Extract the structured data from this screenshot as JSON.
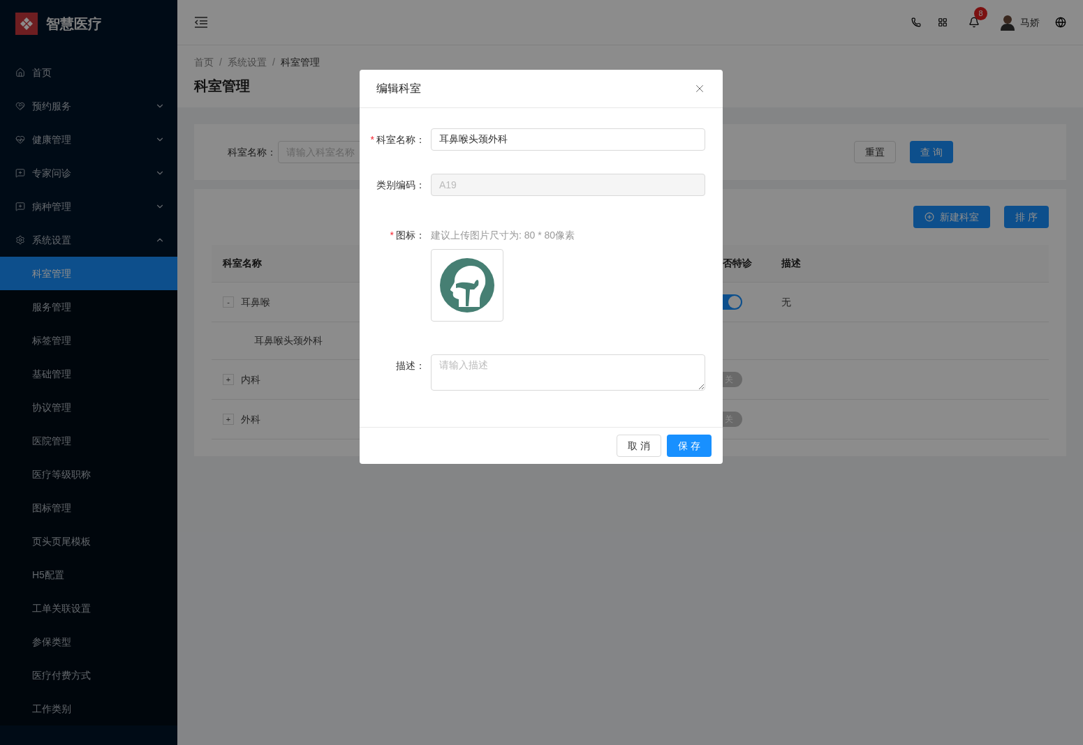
{
  "sidebar": {
    "logo_text": "智慧医疗",
    "items": [
      {
        "label": "首页"
      },
      {
        "label": "预约服务",
        "expanded": false
      },
      {
        "label": "健康管理",
        "expanded": false
      },
      {
        "label": "专家问诊",
        "expanded": false
      },
      {
        "label": "病种管理",
        "expanded": false
      },
      {
        "label": "系统设置",
        "expanded": true,
        "children": [
          {
            "label": "科室管理",
            "selected": true
          },
          {
            "label": "服务管理",
            "selected": false
          },
          {
            "label": "标签管理",
            "selected": false
          },
          {
            "label": "基础管理",
            "selected": false
          },
          {
            "label": "协议管理",
            "selected": false
          },
          {
            "label": "医院管理",
            "selected": false
          },
          {
            "label": "医疗等级职称",
            "selected": false
          },
          {
            "label": "图标管理",
            "selected": false
          },
          {
            "label": "页头页尾模板",
            "selected": false
          },
          {
            "label": "H5配置",
            "selected": false
          },
          {
            "label": "工单关联设置",
            "selected": false
          },
          {
            "label": "参保类型",
            "selected": false
          },
          {
            "label": "医疗付费方式",
            "selected": false
          },
          {
            "label": "工作类别",
            "selected": false
          }
        ]
      }
    ]
  },
  "header": {
    "notification_count": "8",
    "user_name": "马娇"
  },
  "breadcrumb": {
    "separator": "/",
    "items": [
      "首页",
      "系统设置",
      "科室管理"
    ]
  },
  "page_title": "科室管理",
  "search": {
    "label": "科室名称：",
    "placeholder": "请输入科室名称",
    "buttons": [
      {
        "label": "重置",
        "kind": "default"
      },
      {
        "label": "查 询",
        "kind": "primary"
      }
    ]
  },
  "table": {
    "actions": [
      {
        "label": "新建科室",
        "kind": "add"
      },
      {
        "label": "排 序",
        "kind": "plain"
      }
    ],
    "columns": [
      "科室名称",
      "否特诊",
      "描述"
    ],
    "rows": [
      {
        "expander": "-",
        "name": "耳鼻喉",
        "special": {
          "on": true
        },
        "description": "无",
        "children": [
          {
            "name": "耳鼻喉头颈外科"
          }
        ]
      },
      {
        "expander": "+",
        "name": "内科",
        "special": {
          "on": false,
          "label": "关"
        }
      },
      {
        "expander": "+",
        "name": "外科",
        "special": {
          "on": false,
          "label": "关"
        }
      }
    ]
  },
  "dialog": {
    "title": "编辑科室",
    "fields": [
      {
        "kind": "text",
        "required_mark": "*",
        "label": "科室名称：",
        "value": "耳鼻喉头颈外科",
        "disabled": false
      },
      {
        "kind": "text",
        "label": "类别编码：",
        "value": "A19",
        "disabled": true
      },
      {
        "kind": "image",
        "required_mark": "*",
        "label": "图标：",
        "hint": "建议上传图片尺寸为: 80 * 80像素"
      },
      {
        "kind": "textarea",
        "label": "描述：",
        "placeholder": "请输入描述"
      }
    ],
    "buttons": [
      {
        "label": "取 消",
        "kind": "default"
      },
      {
        "label": "保 存",
        "kind": "primary"
      }
    ]
  }
}
